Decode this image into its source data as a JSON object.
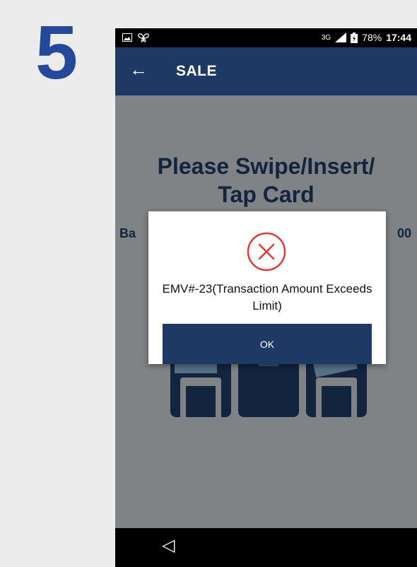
{
  "step": {
    "number": "5"
  },
  "status_bar": {
    "network": "3G",
    "battery": "78%",
    "time": "17:44"
  },
  "app_bar": {
    "title": "SALE",
    "back_icon": "←"
  },
  "main": {
    "prompt_line1": "Please Swipe/Insert/",
    "prompt_line2": "Tap Card",
    "balance_label": "Ba",
    "balance_value": "00"
  },
  "dialog": {
    "message_line1": "EMV#-23(Transaction Amount Exceeds",
    "message_line2": "Limit)",
    "ok_label": "OK"
  },
  "nav_bar": {
    "back_icon": "◁"
  },
  "colors": {
    "brand": "#1e3a64",
    "step_number": "#24489a",
    "error": "#e53935"
  }
}
